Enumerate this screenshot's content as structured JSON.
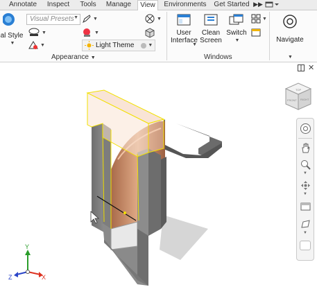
{
  "tabs": [
    {
      "label": "Annotate",
      "active": false
    },
    {
      "label": "Inspect",
      "active": false
    },
    {
      "label": "Tools",
      "active": false
    },
    {
      "label": "Manage",
      "active": false
    },
    {
      "label": "View",
      "active": true
    },
    {
      "label": "Environments",
      "active": false
    },
    {
      "label": "Get Started",
      "active": false
    }
  ],
  "ribbon": {
    "visual_style_label": "al Style",
    "visual_presets_placeholder": "Visual Presets",
    "light_theme_label": "Light Theme",
    "appearance_panel_title": "Appearance",
    "user_interface_label": "User Interface",
    "user_interface_line1": "User",
    "user_interface_line2": "Interface",
    "clean_screen_line1": "Clean",
    "clean_screen_line2": "Screen",
    "switch_label": "Switch",
    "windows_panel_title": "Windows",
    "navigate_label": "Navigate"
  },
  "viewport": {
    "viewcube_faces": [
      "TOP",
      "FRONT",
      "RIGHT"
    ],
    "triad": {
      "x": "X",
      "y": "Y",
      "z": "Z"
    }
  },
  "colors": {
    "tab_bg": "#ececec",
    "ribbon_bg": "#fbfbfb",
    "highlight_yellow": "#f2e000",
    "copper": "#c98c66",
    "grey_part": "#8a8a8a"
  }
}
